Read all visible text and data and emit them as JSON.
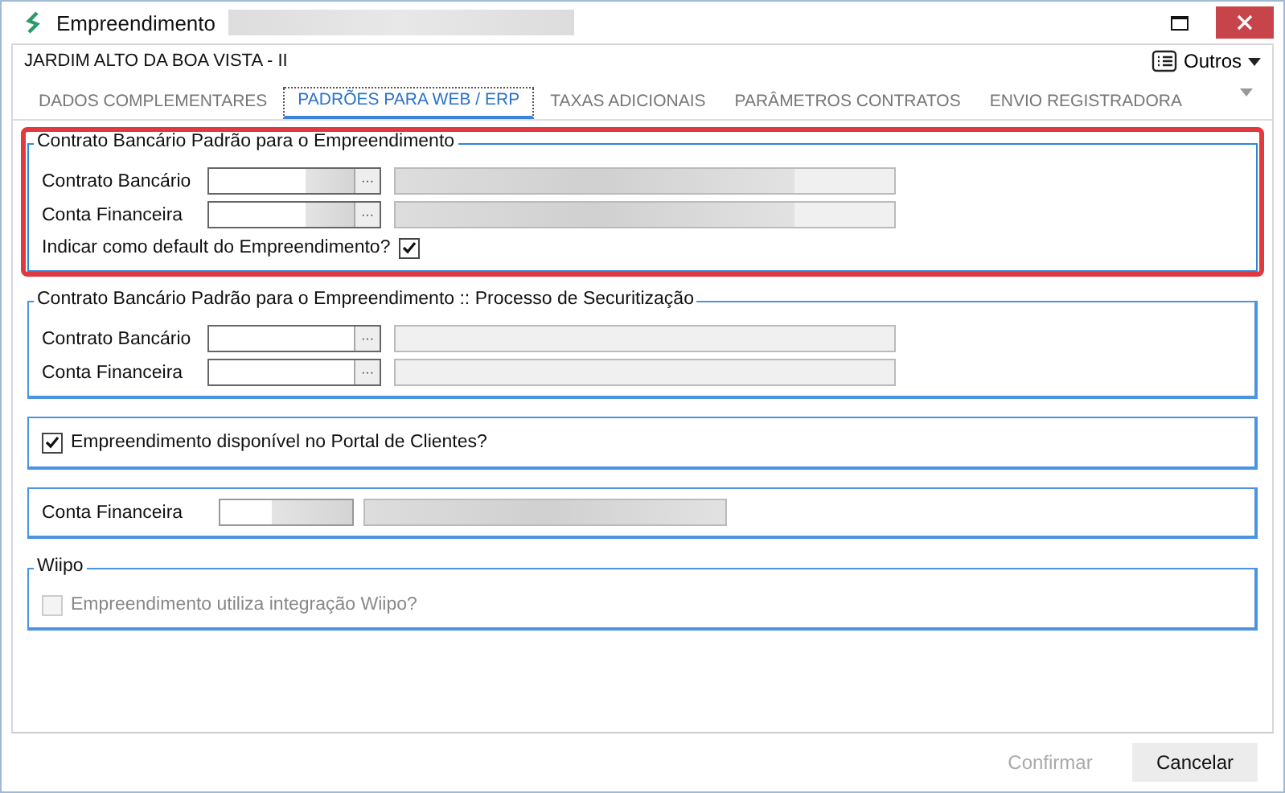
{
  "window": {
    "title": "Empreendimento",
    "title_blurred": true
  },
  "header": {
    "title": "JARDIM ALTO DA BOA VISTA - II",
    "menu_button": "Outros"
  },
  "tabs": [
    {
      "label": "DADOS COMPLEMENTARES",
      "selected": false
    },
    {
      "label": "PADRÕES PARA WEB / ERP",
      "selected": true
    },
    {
      "label": "TAXAS ADICIONAIS",
      "selected": false
    },
    {
      "label": "PARÂMETROS CONTRATOS",
      "selected": false
    },
    {
      "label": "ENVIO REGISTRADORA",
      "selected": false
    }
  ],
  "groups": [
    {
      "kind": "lookups",
      "title": "Contrato Bancário Padrão para o Empreendimento",
      "highlighted": true,
      "fields": [
        {
          "label": "Contrato Bancário",
          "button": "···",
          "blurred": true
        },
        {
          "label": "Conta Financeira",
          "button": "···",
          "blurred": true
        }
      ],
      "checkbox": {
        "label": "Indicar como default do Empreendimento?",
        "checked": true,
        "disabled": false
      }
    },
    {
      "kind": "lookups",
      "title": "Contrato Bancário Padrão para o Empreendimento  :: Processo de Securitização",
      "highlighted": false,
      "fields": [
        {
          "label": "Contrato Bancário",
          "button": "···",
          "blurred": false
        },
        {
          "label": "Conta Financeira",
          "button": "···",
          "blurred": false
        }
      ]
    },
    {
      "kind": "check",
      "highlighted": false,
      "checkbox": {
        "label": "Empreendimento disponível no Portal de Clientes?",
        "checked": true,
        "disabled": false
      }
    },
    {
      "kind": "single",
      "highlighted": false,
      "fields": [
        {
          "label": "Conta Financeira",
          "blurred": true
        }
      ]
    },
    {
      "kind": "check",
      "title": "Wiipo",
      "highlighted": false,
      "checkbox": {
        "label": "Empreendimento utiliza integração Wiipo?",
        "checked": false,
        "disabled": true
      }
    }
  ],
  "buttons": [
    {
      "label": "Confirmar",
      "disabled": true
    },
    {
      "label": "Cancelar",
      "disabled": false
    }
  ]
}
